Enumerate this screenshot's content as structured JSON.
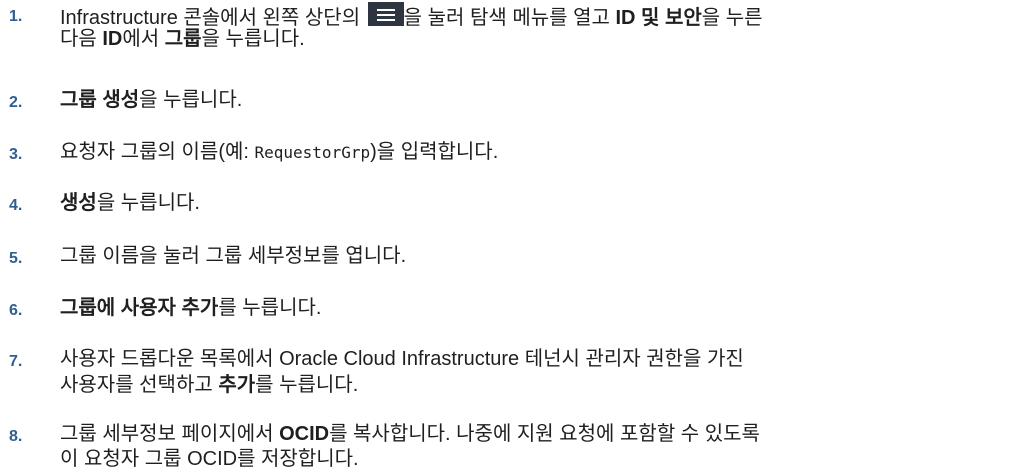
{
  "steps": [
    {
      "number": "1.",
      "line1": [
        {
          "t": "Infrastructure 콘솔에서 왼쪽 상단의 "
        },
        {
          "icon": "hamburger-menu-icon"
        },
        {
          "t": "을 눌러 탐색 메뉴를 열고 "
        },
        {
          "b": "ID 및 보안"
        },
        {
          "t": "을 누른"
        }
      ],
      "line2": [
        {
          "t": "다음 "
        },
        {
          "b": "ID"
        },
        {
          "t": "에서 "
        },
        {
          "b": "그룹"
        },
        {
          "t": "을 누릅니다."
        }
      ]
    },
    {
      "number": "2.",
      "line1": [
        {
          "b": "그룹 생성"
        },
        {
          "t": "을 누릅니다."
        }
      ]
    },
    {
      "number": "3.",
      "line1": [
        {
          "t": "요청자 그룹의 이름(예: "
        },
        {
          "code": "RequestorGrp"
        },
        {
          "t": ")을 입력합니다."
        }
      ]
    },
    {
      "number": "4.",
      "line1": [
        {
          "b": "생성"
        },
        {
          "t": "을 누릅니다."
        }
      ]
    },
    {
      "number": "5.",
      "line1": [
        {
          "t": "그룹 이름을 눌러 그룹 세부정보를 엽니다."
        }
      ]
    },
    {
      "number": "6.",
      "line1": [
        {
          "b": "그룹에 사용자 추가"
        },
        {
          "t": "를 누릅니다."
        }
      ]
    },
    {
      "number": "7.",
      "line1": [
        {
          "t": "사용자 드롭다운 목록에서 Oracle Cloud Infrastructure 테넌시 관리자 권한을 가진"
        }
      ],
      "line2": [
        {
          "t": "사용자를 선택하고 "
        },
        {
          "b": "추가"
        },
        {
          "t": "를 누릅니다."
        }
      ]
    },
    {
      "number": "8.",
      "line1": [
        {
          "t": "그룹 세부정보 페이지에서 "
        },
        {
          "b": "OCID"
        },
        {
          "t": "를 복사합니다. 나중에 지원 요청에 포함할 수 있도록"
        }
      ],
      "line2": [
        {
          "t": "이 요청자 그룹 OCID를 저장합니다."
        }
      ]
    }
  ]
}
